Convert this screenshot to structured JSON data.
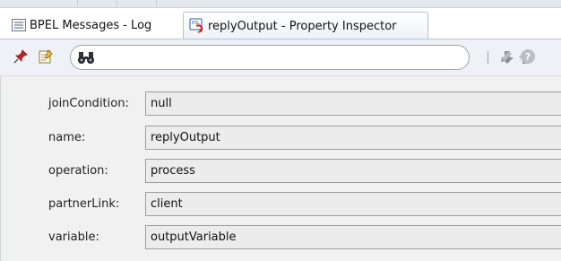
{
  "tabs": [
    {
      "label": "BPEL Messages - Log",
      "icon": "list-icon",
      "active": false
    },
    {
      "label": "replyOutput - Property Inspector",
      "icon": "reply-activity-icon",
      "active": true
    }
  ],
  "toolbar": {
    "search_value": "",
    "icons": [
      "pin-icon",
      "edit-note-icon",
      "binoculars-icon",
      "arrow-down-icon",
      "arrow-up-icon",
      "pencil-icon",
      "help-icon"
    ]
  },
  "properties": [
    {
      "label": "joinCondition:",
      "value": "null"
    },
    {
      "label": "name:",
      "value": "replyOutput"
    },
    {
      "label": "operation:",
      "value": "process"
    },
    {
      "label": "partnerLink:",
      "value": "client"
    },
    {
      "label": "variable:",
      "value": "outputVariable"
    }
  ],
  "colors": {
    "accent": "#3a6fb5",
    "pin": "#cc1f1f",
    "field_bg": "#ececec",
    "panel_bg": "#f1f1f1"
  }
}
